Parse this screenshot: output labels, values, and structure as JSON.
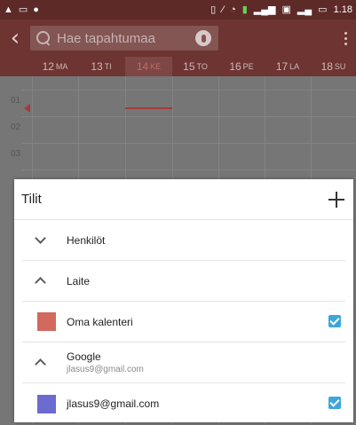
{
  "status_bar": {
    "left_icons": [
      "warning-icon",
      "image-icon",
      "message-icon"
    ],
    "right_icons": [
      "vibrate-icon",
      "signal-off-icon",
      "wifi-icon",
      "battery-saver-icon",
      "cell-signal-icon",
      "sim-icon",
      "cell-signal-2-icon",
      "battery-icon"
    ],
    "battery_text": "1.18"
  },
  "toolbar": {
    "back_icon": "chevron-left-icon",
    "search_placeholder": "Hae tapahtumaa",
    "mic_icon": "microphone-icon",
    "overflow_icon": "more-vert-icon"
  },
  "days": [
    {
      "num": "12",
      "wd": "MA"
    },
    {
      "num": "13",
      "wd": "TI"
    },
    {
      "num": "14",
      "wd": "KE",
      "today": true
    },
    {
      "num": "15",
      "wd": "TO"
    },
    {
      "num": "16",
      "wd": "PE"
    },
    {
      "num": "17",
      "wd": "LA"
    },
    {
      "num": "18",
      "wd": "SU"
    }
  ],
  "hours": [
    "01",
    "02",
    "03"
  ],
  "accounts_sheet": {
    "title": "Tilit",
    "add_icon": "plus-icon",
    "rows": [
      {
        "type": "group",
        "expanded": false,
        "label": "Henkilöt"
      },
      {
        "type": "group",
        "expanded": true,
        "label": "Laite"
      },
      {
        "type": "calendar",
        "label": "Oma kalenteri",
        "color": "#d2695f",
        "checked": true
      },
      {
        "type": "group",
        "expanded": true,
        "label": "Google",
        "sub": "jlasus9@gmail.com"
      },
      {
        "type": "calendar",
        "label": "jlasus9@gmail.com",
        "color": "#6b6bd0",
        "checked": true
      }
    ]
  },
  "colors": {
    "toolbar_bg": "#6d3432",
    "status_bg": "#5e2a28",
    "checkbox": "#3ea6d8",
    "now_line": "#a23b38"
  }
}
